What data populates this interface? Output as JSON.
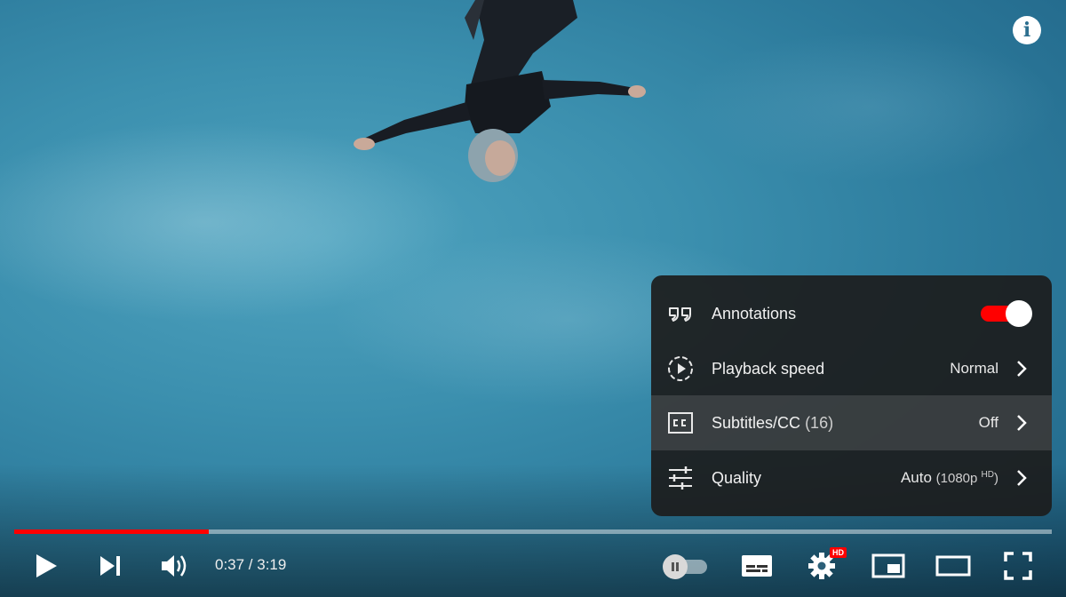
{
  "info_button": {
    "icon": "info-icon"
  },
  "settings_menu": {
    "items": [
      {
        "label": "Annotations",
        "icon": "annotations-icon",
        "toggle_on": true
      },
      {
        "label": "Playback speed",
        "icon": "playback-speed-icon",
        "value": "Normal"
      },
      {
        "label": "Subtitles/CC",
        "count": "(16)",
        "icon": "subtitles-icon",
        "value": "Off",
        "highlighted": true
      },
      {
        "label": "Quality",
        "icon": "quality-sliders-icon",
        "value_main": "Auto",
        "value_detail": "(1080p",
        "value_sup": "HD",
        "value_close": ")"
      }
    ]
  },
  "player": {
    "progress_played_fraction": 0.1875,
    "time": "0:37 / 3:19",
    "hd_badge": "HD",
    "colors": {
      "accent": "#ff0000",
      "menu_bg": "#1c1c1c"
    }
  }
}
